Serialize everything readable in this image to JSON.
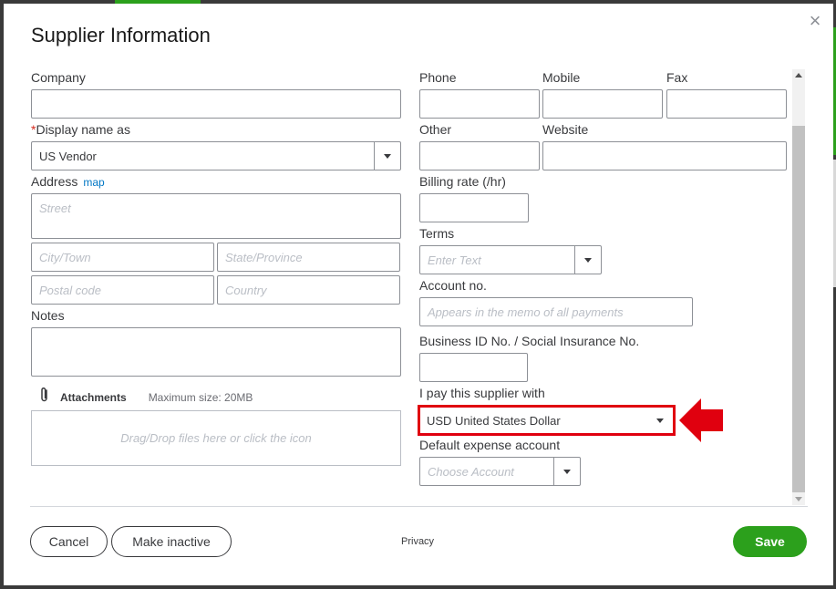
{
  "dialog": {
    "title": "Supplier Information",
    "close_icon": "×"
  },
  "left": {
    "company_label": "Company",
    "company_value": "",
    "display_name_required": "*",
    "display_name_label": "Display name as",
    "display_name_value": "US Vendor",
    "address_label": "Address",
    "map_link": "map",
    "street_placeholder": "Street",
    "city_placeholder": "City/Town",
    "state_placeholder": "State/Province",
    "postal_placeholder": "Postal code",
    "country_placeholder": "Country",
    "notes_label": "Notes",
    "attachments_label": "Attachments",
    "max_size": "Maximum size: 20MB",
    "dropzone_text": "Drag/Drop files here or click the icon"
  },
  "right": {
    "phone_label": "Phone",
    "mobile_label": "Mobile",
    "fax_label": "Fax",
    "other_label": "Other",
    "website_label": "Website",
    "billing_rate_label": "Billing rate (/hr)",
    "terms_label": "Terms",
    "terms_placeholder": "Enter Text",
    "account_no_label": "Account no.",
    "account_no_placeholder": "Appears in the memo of all payments",
    "business_id_label": "Business ID No. / Social Insurance No.",
    "pay_with_label": "I pay this supplier with",
    "pay_with_value": "USD United States Dollar",
    "default_expense_label": "Default expense account",
    "default_expense_placeholder": "Choose Account"
  },
  "footer": {
    "cancel_label": "Cancel",
    "make_inactive_label": "Make inactive",
    "privacy_label": "Privacy",
    "save_label": "Save"
  },
  "colors": {
    "accent_green": "#2ca01c",
    "highlight_red": "#e0000f",
    "link_blue": "#0077c5",
    "required_red": "#d52b1e"
  },
  "icons": {
    "close": "close-icon",
    "attachment": "paperclip-icon",
    "dropdown": "chevron-down-icon",
    "annotation": "red-arrow-icon"
  }
}
